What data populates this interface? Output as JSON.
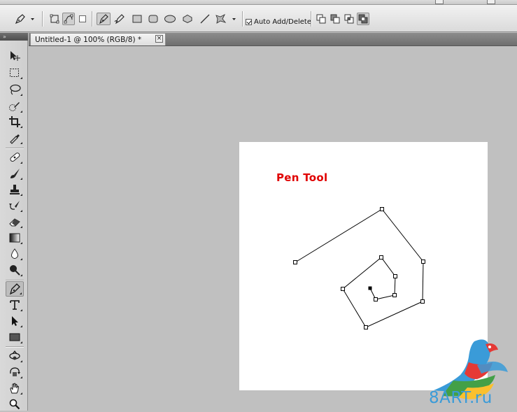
{
  "document": {
    "tab_title": "Untitled-1 @ 100% (RGB/8) *",
    "close_glyph": "×"
  },
  "options_bar": {
    "auto_add_delete_label": "Auto Add/Delete",
    "auto_add_delete_checked": true
  },
  "tools_header": "»",
  "canvas": {
    "background": "#ffffff",
    "title_text": "Pen Tool",
    "title_color": "#e00000",
    "path_stroke": "#000000"
  },
  "watermark": {
    "text": "8ART.ru",
    "colors": {
      "blue": "#3a9bd8",
      "red": "#e53935",
      "green": "#43a047",
      "yellow": "#fbc02d"
    }
  },
  "icons": {
    "tools": [
      "move-icon",
      "marquee-icon",
      "lasso-icon",
      "quick-selection-icon",
      "crop-icon",
      "eyedropper-icon",
      "healing-brush-icon",
      "brush-icon",
      "clone-stamp-icon",
      "history-brush-icon",
      "eraser-icon",
      "gradient-icon",
      "blur-icon",
      "dodge-icon",
      "pen-icon",
      "type-icon",
      "path-selection-icon",
      "rectangle-shape-icon",
      "3d-rotate-icon",
      "3d-orbit-icon",
      "hand-icon",
      "zoom-icon"
    ]
  }
}
